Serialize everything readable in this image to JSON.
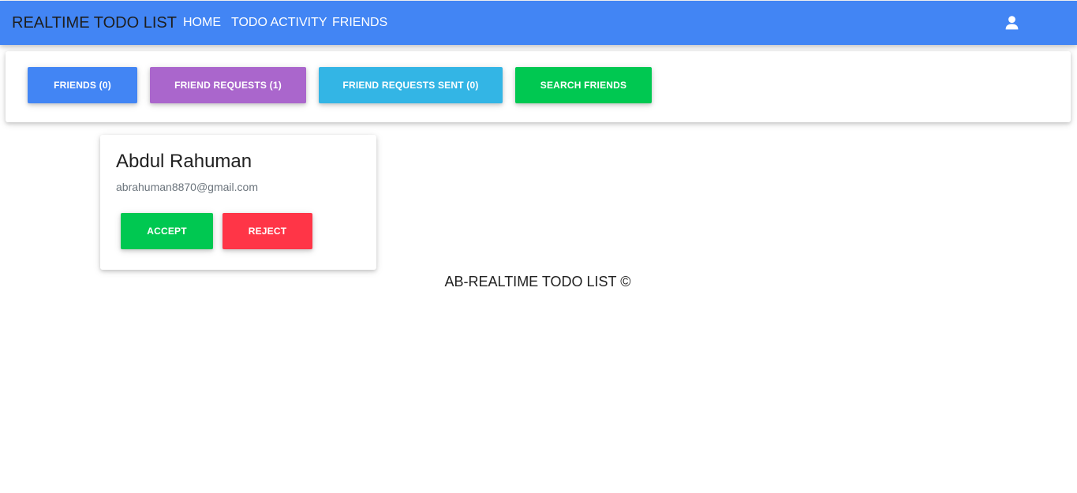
{
  "navbar": {
    "brand": "REALTIME TODO LIST",
    "links": [
      {
        "label": "HOME"
      },
      {
        "label": "TODO ACTIVITY"
      },
      {
        "label": "FRIENDS"
      }
    ],
    "user_icon": "user-icon",
    "background_color": "#4285f4"
  },
  "tabs": [
    {
      "label": "FRIENDS (0)",
      "color": "#4285f4"
    },
    {
      "label": "FRIEND REQUESTS (1)",
      "color": "#aa66cc"
    },
    {
      "label": "FRIEND REQUESTS SENT (0)",
      "color": "#33b5e5"
    },
    {
      "label": "SEARCH FRIENDS",
      "color": "#00c851"
    }
  ],
  "request_card": {
    "name": "Abdul Rahuman",
    "email": "abrahuman8870@gmail.com",
    "accept_label": "ACCEPT",
    "accept_color": "#00c851",
    "reject_label": "REJECT",
    "reject_color": "#ff3547"
  },
  "footer": {
    "text": "AB-REALTIME TODO LIST ©"
  }
}
